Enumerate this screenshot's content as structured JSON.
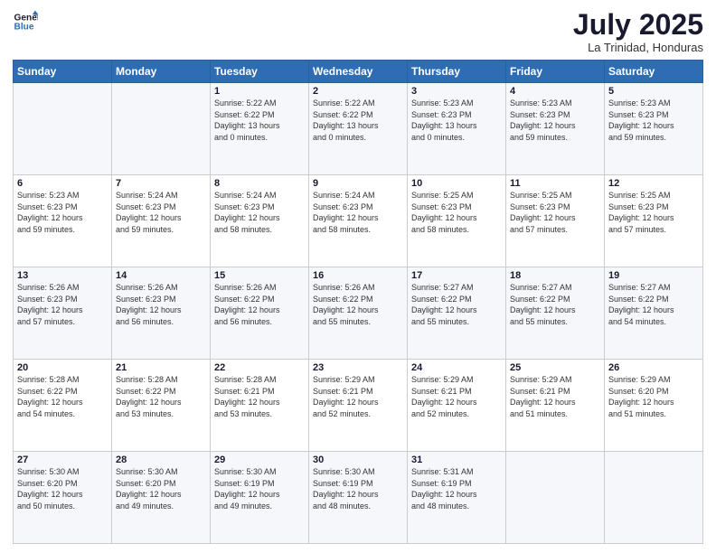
{
  "header": {
    "logo_line1": "General",
    "logo_line2": "Blue",
    "month": "July 2025",
    "location": "La Trinidad, Honduras"
  },
  "days_of_week": [
    "Sunday",
    "Monday",
    "Tuesday",
    "Wednesday",
    "Thursday",
    "Friday",
    "Saturday"
  ],
  "weeks": [
    [
      {
        "day": "",
        "info": ""
      },
      {
        "day": "",
        "info": ""
      },
      {
        "day": "1",
        "info": "Sunrise: 5:22 AM\nSunset: 6:22 PM\nDaylight: 13 hours\nand 0 minutes."
      },
      {
        "day": "2",
        "info": "Sunrise: 5:22 AM\nSunset: 6:22 PM\nDaylight: 13 hours\nand 0 minutes."
      },
      {
        "day": "3",
        "info": "Sunrise: 5:23 AM\nSunset: 6:23 PM\nDaylight: 13 hours\nand 0 minutes."
      },
      {
        "day": "4",
        "info": "Sunrise: 5:23 AM\nSunset: 6:23 PM\nDaylight: 12 hours\nand 59 minutes."
      },
      {
        "day": "5",
        "info": "Sunrise: 5:23 AM\nSunset: 6:23 PM\nDaylight: 12 hours\nand 59 minutes."
      }
    ],
    [
      {
        "day": "6",
        "info": "Sunrise: 5:23 AM\nSunset: 6:23 PM\nDaylight: 12 hours\nand 59 minutes."
      },
      {
        "day": "7",
        "info": "Sunrise: 5:24 AM\nSunset: 6:23 PM\nDaylight: 12 hours\nand 59 minutes."
      },
      {
        "day": "8",
        "info": "Sunrise: 5:24 AM\nSunset: 6:23 PM\nDaylight: 12 hours\nand 58 minutes."
      },
      {
        "day": "9",
        "info": "Sunrise: 5:24 AM\nSunset: 6:23 PM\nDaylight: 12 hours\nand 58 minutes."
      },
      {
        "day": "10",
        "info": "Sunrise: 5:25 AM\nSunset: 6:23 PM\nDaylight: 12 hours\nand 58 minutes."
      },
      {
        "day": "11",
        "info": "Sunrise: 5:25 AM\nSunset: 6:23 PM\nDaylight: 12 hours\nand 57 minutes."
      },
      {
        "day": "12",
        "info": "Sunrise: 5:25 AM\nSunset: 6:23 PM\nDaylight: 12 hours\nand 57 minutes."
      }
    ],
    [
      {
        "day": "13",
        "info": "Sunrise: 5:26 AM\nSunset: 6:23 PM\nDaylight: 12 hours\nand 57 minutes."
      },
      {
        "day": "14",
        "info": "Sunrise: 5:26 AM\nSunset: 6:23 PM\nDaylight: 12 hours\nand 56 minutes."
      },
      {
        "day": "15",
        "info": "Sunrise: 5:26 AM\nSunset: 6:22 PM\nDaylight: 12 hours\nand 56 minutes."
      },
      {
        "day": "16",
        "info": "Sunrise: 5:26 AM\nSunset: 6:22 PM\nDaylight: 12 hours\nand 55 minutes."
      },
      {
        "day": "17",
        "info": "Sunrise: 5:27 AM\nSunset: 6:22 PM\nDaylight: 12 hours\nand 55 minutes."
      },
      {
        "day": "18",
        "info": "Sunrise: 5:27 AM\nSunset: 6:22 PM\nDaylight: 12 hours\nand 55 minutes."
      },
      {
        "day": "19",
        "info": "Sunrise: 5:27 AM\nSunset: 6:22 PM\nDaylight: 12 hours\nand 54 minutes."
      }
    ],
    [
      {
        "day": "20",
        "info": "Sunrise: 5:28 AM\nSunset: 6:22 PM\nDaylight: 12 hours\nand 54 minutes."
      },
      {
        "day": "21",
        "info": "Sunrise: 5:28 AM\nSunset: 6:22 PM\nDaylight: 12 hours\nand 53 minutes."
      },
      {
        "day": "22",
        "info": "Sunrise: 5:28 AM\nSunset: 6:21 PM\nDaylight: 12 hours\nand 53 minutes."
      },
      {
        "day": "23",
        "info": "Sunrise: 5:29 AM\nSunset: 6:21 PM\nDaylight: 12 hours\nand 52 minutes."
      },
      {
        "day": "24",
        "info": "Sunrise: 5:29 AM\nSunset: 6:21 PM\nDaylight: 12 hours\nand 52 minutes."
      },
      {
        "day": "25",
        "info": "Sunrise: 5:29 AM\nSunset: 6:21 PM\nDaylight: 12 hours\nand 51 minutes."
      },
      {
        "day": "26",
        "info": "Sunrise: 5:29 AM\nSunset: 6:20 PM\nDaylight: 12 hours\nand 51 minutes."
      }
    ],
    [
      {
        "day": "27",
        "info": "Sunrise: 5:30 AM\nSunset: 6:20 PM\nDaylight: 12 hours\nand 50 minutes."
      },
      {
        "day": "28",
        "info": "Sunrise: 5:30 AM\nSunset: 6:20 PM\nDaylight: 12 hours\nand 49 minutes."
      },
      {
        "day": "29",
        "info": "Sunrise: 5:30 AM\nSunset: 6:19 PM\nDaylight: 12 hours\nand 49 minutes."
      },
      {
        "day": "30",
        "info": "Sunrise: 5:30 AM\nSunset: 6:19 PM\nDaylight: 12 hours\nand 48 minutes."
      },
      {
        "day": "31",
        "info": "Sunrise: 5:31 AM\nSunset: 6:19 PM\nDaylight: 12 hours\nand 48 minutes."
      },
      {
        "day": "",
        "info": ""
      },
      {
        "day": "",
        "info": ""
      }
    ]
  ]
}
